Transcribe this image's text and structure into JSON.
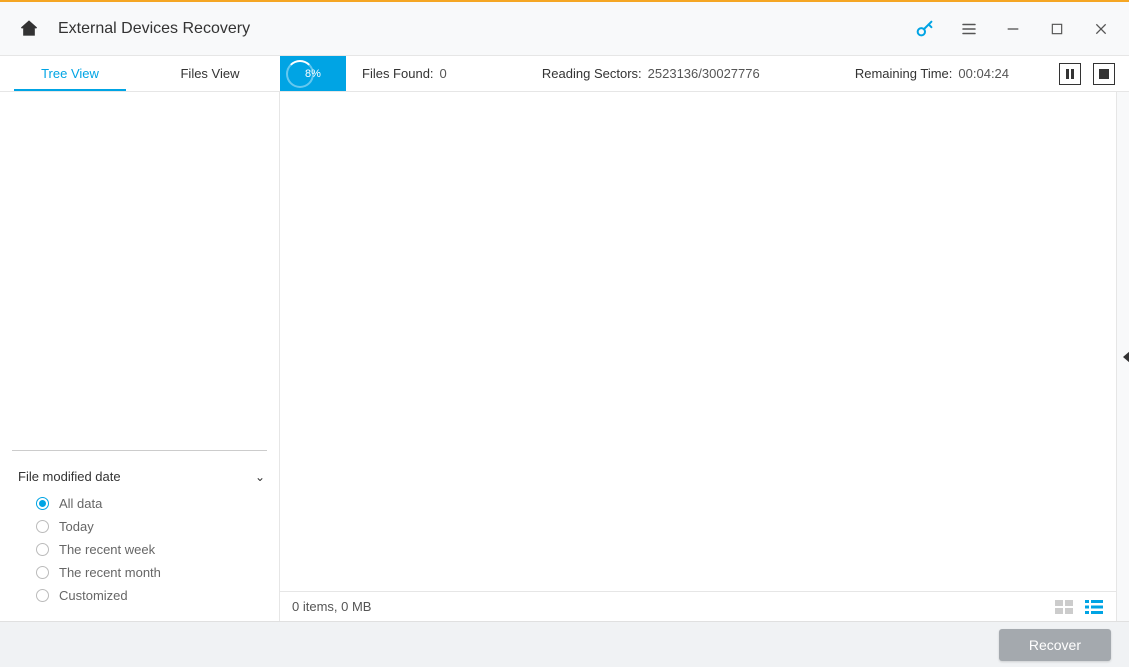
{
  "title": "External Devices Recovery",
  "tabs": {
    "tree": "Tree View",
    "files": "Files View",
    "active": "tree"
  },
  "progress": {
    "percent": "8%"
  },
  "status": {
    "files_found_label": "Files Found:",
    "files_found_value": "0",
    "sectors_label": "Reading Sectors:",
    "sectors_value": "2523136/30027776",
    "remaining_label": "Remaining Time:",
    "remaining_value": "00:04:24"
  },
  "filter": {
    "heading": "File modified date",
    "options": [
      "All data",
      "Today",
      "The recent week",
      "The recent month",
      "Customized"
    ],
    "selected_index": 0
  },
  "content_status": "0 items, 0 MB",
  "footer": {
    "recover": "Recover"
  }
}
